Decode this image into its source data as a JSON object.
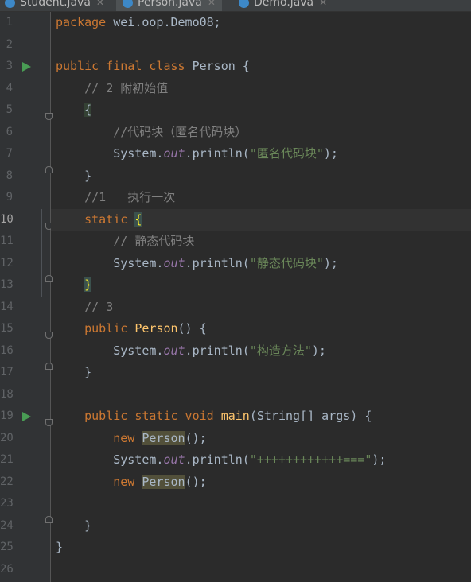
{
  "tabs": [
    {
      "label": "Student.java",
      "active": false
    },
    {
      "label": "Person.java",
      "active": true
    },
    {
      "label": "Demo.java",
      "active": false
    }
  ],
  "lines": [
    {
      "n": "1",
      "html": "<span class='kw'>package</span> wei.oop.Demo08;"
    },
    {
      "n": "2",
      "html": ""
    },
    {
      "n": "3",
      "html": "<span class='kw'>public final class</span> Person {"
    },
    {
      "n": "4",
      "html": "    <span class='cmt'>// 2 附初始值</span>"
    },
    {
      "n": "5",
      "html": "    <span class='hl'>{</span>"
    },
    {
      "n": "6",
      "html": "        <span class='cmt'>//代码块（匿名代码块）</span>"
    },
    {
      "n": "7",
      "html": "        System.<span class='out'>out</span>.println(<span class='str'>\"匿名代码块\"</span>);"
    },
    {
      "n": "8",
      "html": "    }"
    },
    {
      "n": "9",
      "html": "    <span class='cmt'>//1   执行一次</span>"
    },
    {
      "n": "10",
      "html": "    <span class='kw'>static</span> <span class='brace-match'>{</span>"
    },
    {
      "n": "11",
      "html": "        <span class='cmt'>// 静态代码块</span>"
    },
    {
      "n": "12",
      "html": "        System.<span class='out'>out</span>.println(<span class='str'>\"静态代码块\"</span>);"
    },
    {
      "n": "13",
      "html": "    <span class='brace-match'>}</span>"
    },
    {
      "n": "14",
      "html": "    <span class='cmt'>// 3</span>"
    },
    {
      "n": "15",
      "html": "    <span class='kw'>public</span> <span class='fn'>Person</span>() {"
    },
    {
      "n": "16",
      "html": "        System.<span class='out'>out</span>.println(<span class='str'>\"构造方法\"</span>);"
    },
    {
      "n": "17",
      "html": "    }"
    },
    {
      "n": "18",
      "html": ""
    },
    {
      "n": "19",
      "html": "    <span class='kw'>public static void</span> <span class='fn'>main</span>(String[] args) {"
    },
    {
      "n": "20",
      "html": "        <span class='kw'>new</span> <span class='uhl'>Person</span>();"
    },
    {
      "n": "21",
      "html": "        System.<span class='out'>out</span>.println(<span class='str'>\"++++++++++++===\"</span>);"
    },
    {
      "n": "22",
      "html": "        <span class='kw'>new</span> <span class='uhl'>Person</span>();"
    },
    {
      "n": "23",
      "html": ""
    },
    {
      "n": "24",
      "html": "    }"
    },
    {
      "n": "25",
      "html": "}"
    },
    {
      "n": "26",
      "html": ""
    }
  ],
  "current_line": "10",
  "run_lines": [
    "3",
    "19"
  ],
  "fold_top_lines": [
    "5",
    "10",
    "15",
    "19"
  ],
  "fold_bottom_lines": [
    "8",
    "13",
    "17",
    "24"
  ],
  "colors": {
    "background": "#2b2b2b",
    "keyword": "#cc7832",
    "string": "#6a8759",
    "comment": "#808080",
    "static_field": "#9876aa",
    "method_decl": "#ffc66d",
    "run_icon": "#499c54"
  }
}
